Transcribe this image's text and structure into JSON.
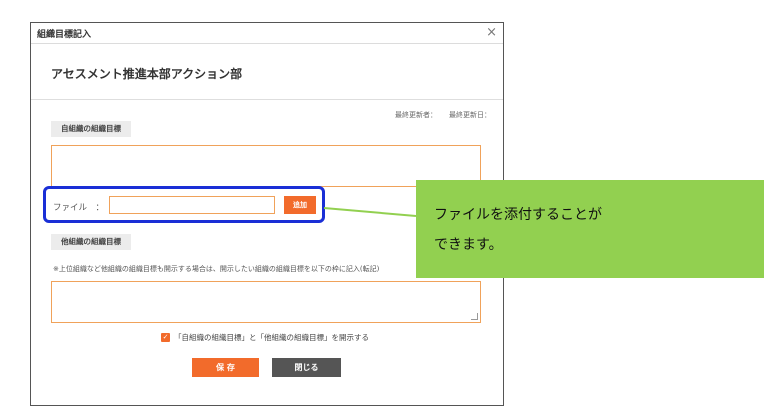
{
  "dialog": {
    "title": "組織目標記入",
    "close_symbol": "×",
    "org_name": "アセスメント推進本部アクション部",
    "last_updater_label": "最終更新者：",
    "last_updated_label": "最終更新日：",
    "own_goal_label": "自組織の組織目標",
    "file_label": "ファイル　：",
    "add_button": "追加",
    "other_goal_label": "他組織の組織目標",
    "note": "※上位組織など他組織の組織目標も開示する場合は、開示したい組織の組織目標を以下の枠に記入(転記)",
    "disclose_checkbox_label": "「自組織の組織目標」と「他組織の組織目標」を開示する",
    "disclose_checked": true,
    "save_button": "保 存",
    "close_button": "閉じる"
  },
  "callout": {
    "line1": "ファイルを添付することが",
    "line2": "できます。"
  },
  "colors": {
    "accent_orange": "#f26b2b",
    "field_border": "#f0a25a",
    "highlight_blue": "#1a2fd6",
    "callout_green": "#92d050",
    "close_button_gray": "#555555"
  }
}
